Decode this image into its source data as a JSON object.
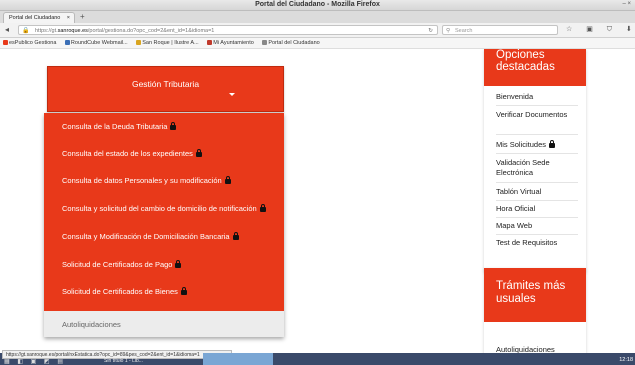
{
  "window": {
    "title": "Portal del Ciudadano - Mozilla Firefox",
    "controls": "– ×"
  },
  "tab": {
    "label": "Portal del Ciudadano",
    "close": "×",
    "new_tab": "+"
  },
  "navbar": {
    "back": "◂",
    "url_prefix": "https://gt.",
    "url_domain": "sanroque.es",
    "url_rest": "/portal/gestiona.do?opc_cod=2&ent_id=1&idioma=1",
    "reload": "↻",
    "search_placeholder": "Search",
    "icons": "☆ ▣ ⛉ ⬇ ⌂"
  },
  "bookmarks": [
    {
      "label": "esPublico Gestiona",
      "color": "#e8391a"
    },
    {
      "label": "RoundCube Webmail...",
      "color": "#3b6fb6"
    },
    {
      "label": "San Roque | Ilustre A...",
      "color": "#d9a520"
    },
    {
      "label": "Mi Ayuntamiento",
      "color": "#c0392b"
    },
    {
      "label": "Portal del Ciudadano",
      "color": "#888888"
    }
  ],
  "dropdown": {
    "label": "Gestión Tributaria",
    "accent": "#e8391a"
  },
  "menu_items": [
    {
      "label": "Consulta de la Deuda Tributaria",
      "locked": true
    },
    {
      "label": "Consulta del estado de los expedientes",
      "locked": true
    },
    {
      "label": "Consulta de datos Personales y su modificación",
      "locked": true
    },
    {
      "label": "Consulta y solicitud del cambio de domicilio de notificación",
      "locked": true
    },
    {
      "label": "Consulta y Modificación de Domiciliación Bancaria",
      "locked": true
    },
    {
      "label": "Solicitud de Certificados de Pago",
      "locked": true
    },
    {
      "label": "Solicitud de Certificados de Bienes",
      "locked": true
    }
  ],
  "menu_last": {
    "label": "Autoliquidaciones"
  },
  "sidebar": {
    "title": "Opciones destacadas",
    "items": [
      {
        "label": "Bienvenida"
      },
      {
        "label": "Verificar Documentos"
      },
      {
        "label": "Mis Solicitudes",
        "locked": true
      },
      {
        "label": "Validación Sede Electrónica"
      },
      {
        "label": "Tablón Virtual"
      },
      {
        "label": "Hora Oficial"
      },
      {
        "label": "Mapa Web"
      },
      {
        "label": "Test de Requisitos"
      }
    ]
  },
  "sidebar2": {
    "title": "Trámites más usuales",
    "first_item": "Autoliquidaciones"
  },
  "status": {
    "url": "https://gt.sanroque.es/portal/nxEstatica.do?opc_id=89&pes_cod=2&ent_id=1&idioma=1",
    "taskbar_window": "Sin título 1 - Lib...",
    "clock": "12:18"
  }
}
